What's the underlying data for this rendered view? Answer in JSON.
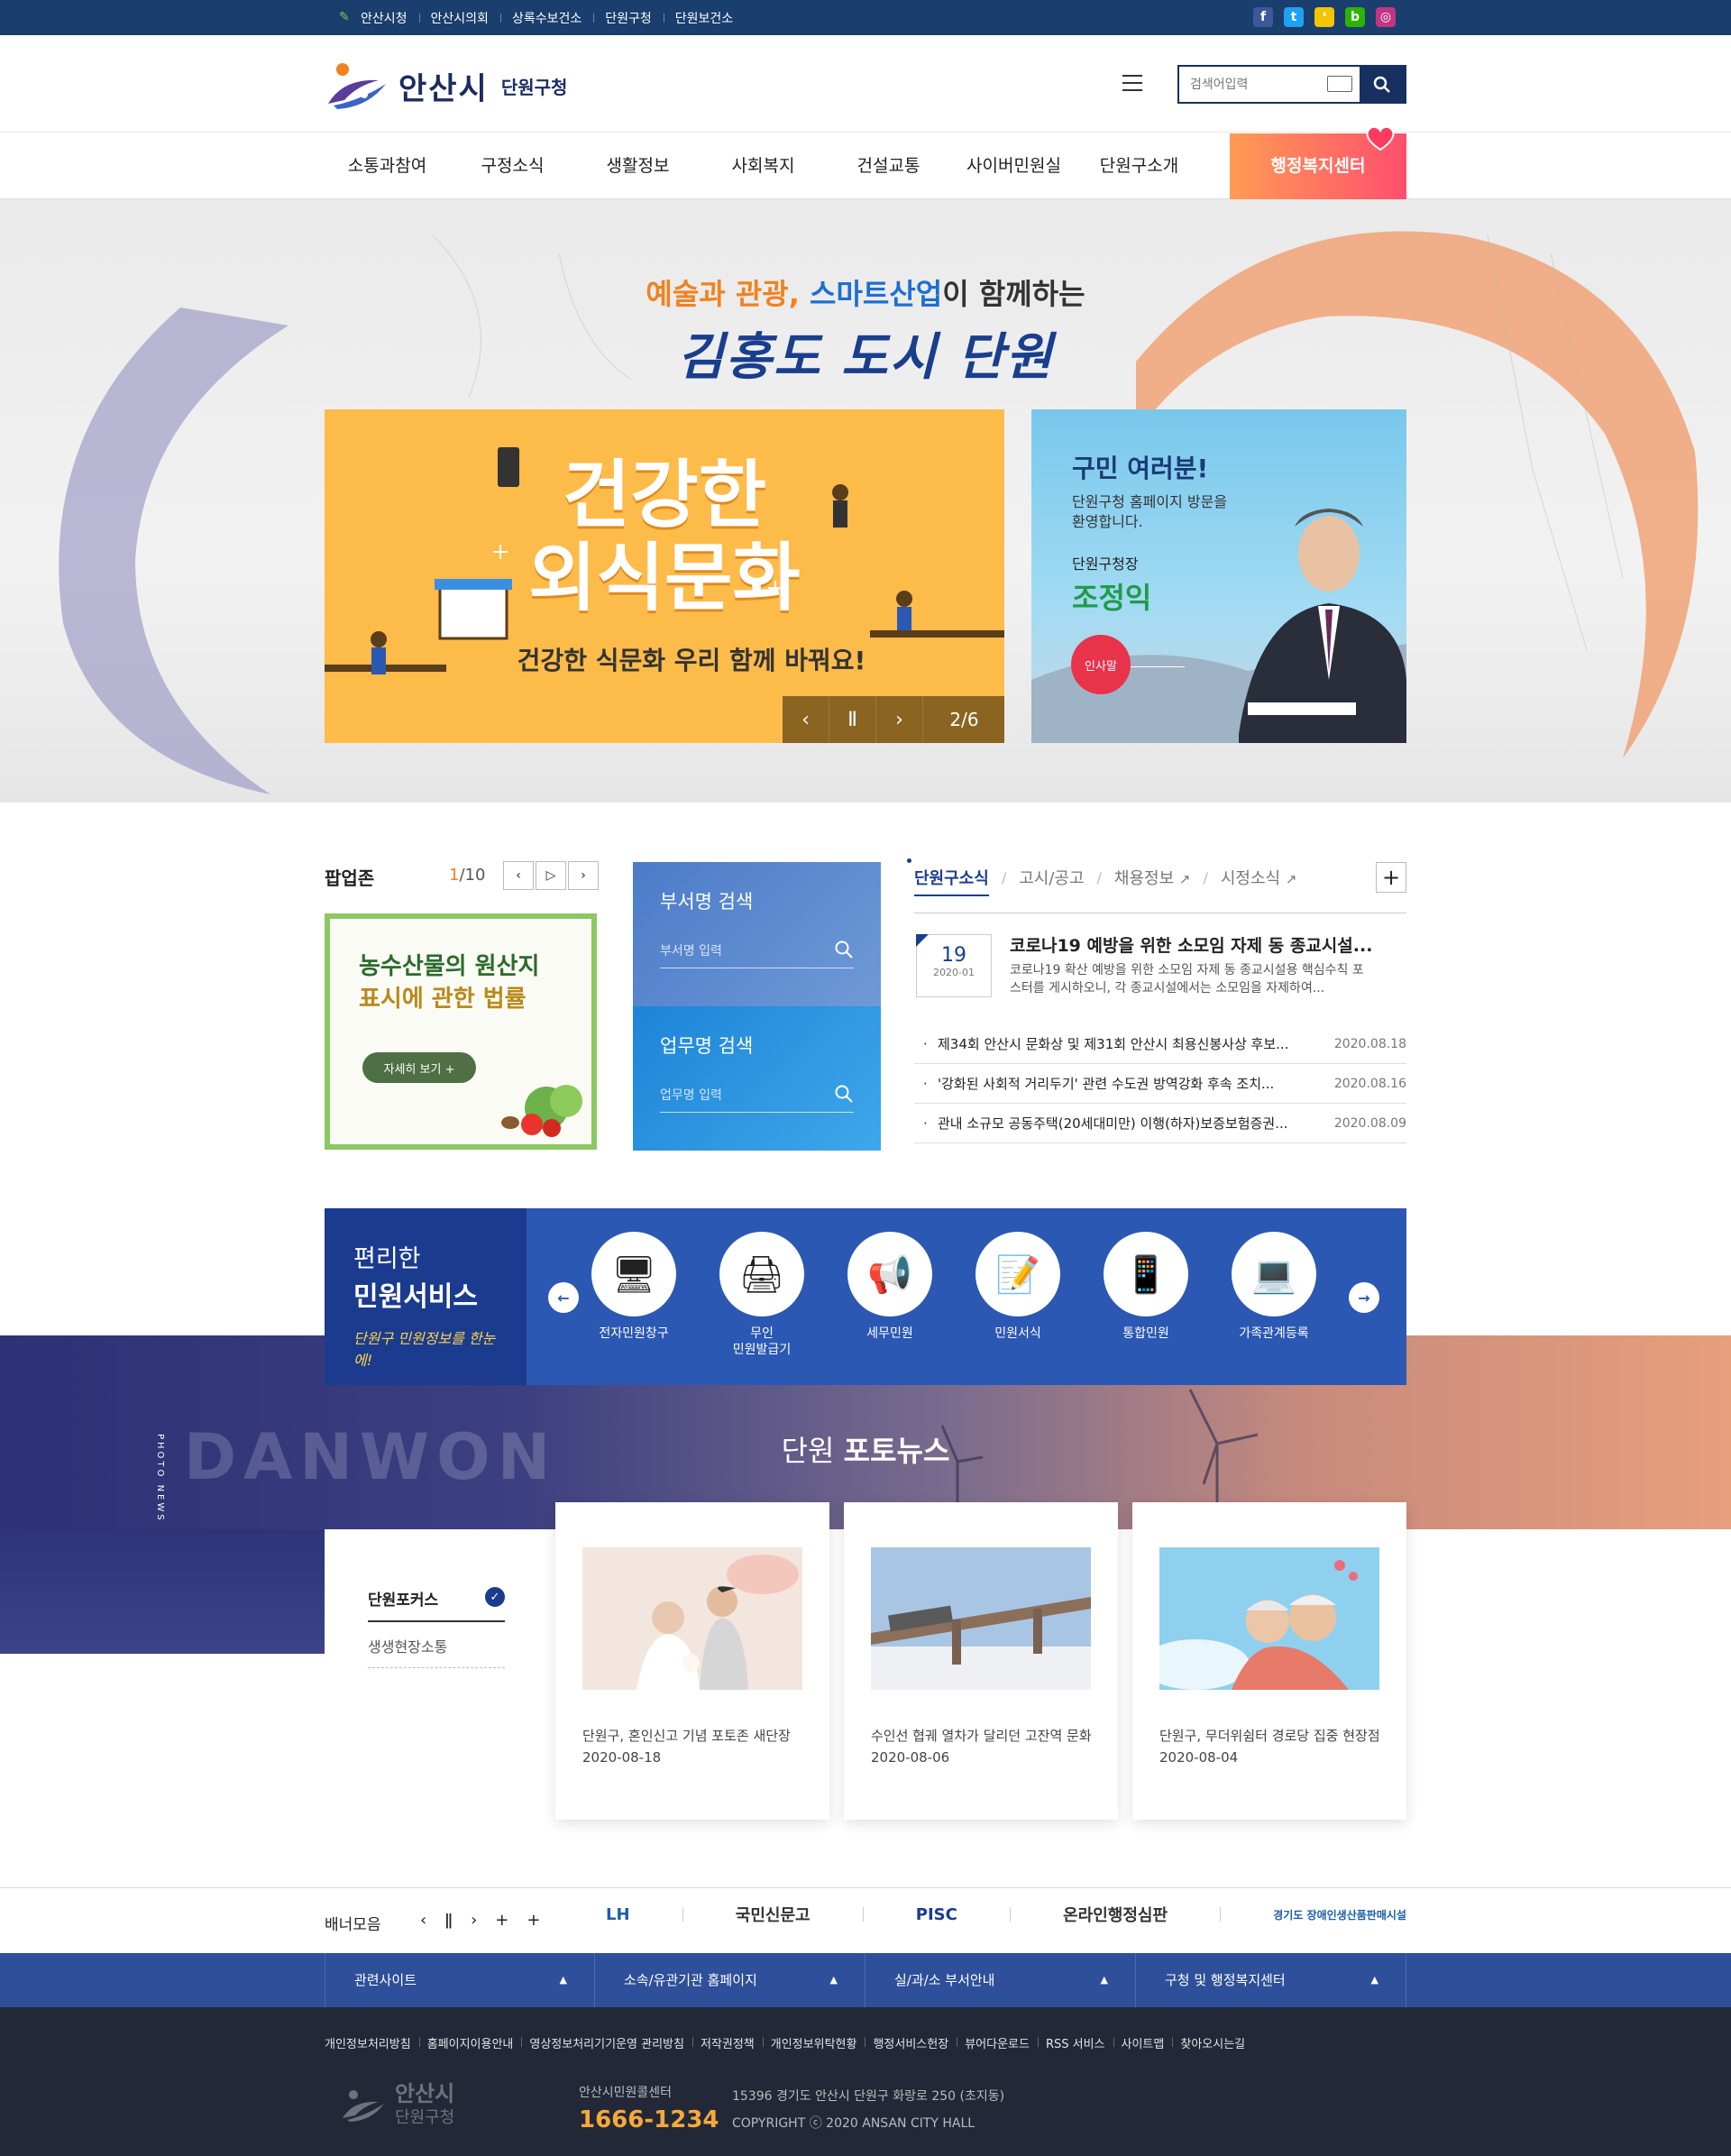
{
  "topbar": {
    "links": [
      "안산시청",
      "안산시의회",
      "상록수보건소",
      "단원구청",
      "단원보건소"
    ],
    "active_index": 0,
    "social_icons": [
      "facebook-icon",
      "twitter-icon",
      "kakaostory-icon",
      "blog-icon",
      "instagram-icon"
    ],
    "social_glyphs": [
      "f",
      "t",
      "❛",
      "b",
      "◎"
    ],
    "social_colors": [
      "#3b5998",
      "#1da1f2",
      "#f4c400",
      "#2db400",
      "#c13584"
    ]
  },
  "header": {
    "logo_main": "안산시",
    "logo_sub": "단원구청",
    "search_placeholder": "검색어입력"
  },
  "gnb": {
    "items": [
      "소통과참여",
      "구정소식",
      "생활정보",
      "사회복지",
      "건설교통",
      "사이버민원실",
      "단원구소개"
    ],
    "special": "행정복지센터",
    "special_colors": [
      "#ff9b54",
      "#ff4f6e"
    ]
  },
  "visual": {
    "slogan_orange": "예술과 관광,",
    "slogan_blue": "스마트산업",
    "slogan_rest": "이 함께하는",
    "slogan_main": "김홍도 도시 단원",
    "banner_title_1": "건강한",
    "banner_title_2": "외식문화",
    "banner_subtitle": "건강한 식문화 우리 함께 바꿔요!",
    "banner_page": "2/6",
    "mayor_greeting": "구민 여러분!",
    "mayor_desc": "단원구청 홈페이지 방문을 환영합니다.",
    "mayor_role": "단원구청장",
    "mayor_name": "조정익",
    "mayor_button": "인사말"
  },
  "popupzone": {
    "title": "팝업존",
    "current": "1",
    "total": "/10",
    "popup_title_1": "농수산물의 원산지",
    "popup_title_2": "표시에 관한 법률",
    "popup_more": "자세히 보기 +"
  },
  "dept_search": {
    "dept_label": "부서명 검색",
    "dept_placeholder": "부서명 입력",
    "task_label": "업무명 검색",
    "task_placeholder": "업무명 입력"
  },
  "news": {
    "tabs": [
      "단원구소식",
      "고시/공고",
      "채용정보",
      "시정소식"
    ],
    "active_tab": 0,
    "featured": {
      "day": "19",
      "month": "2020-01",
      "title": "코로나19 예방을 위한 소모임 자제 동 종교시설...",
      "desc": "코로나19 확산 예방을 위한 소모임 자제 동 종교시설용 핵심수칙 포스터를 게시하오니, 각 종교시설에서는 소모임을 자제하여..."
    },
    "list": [
      {
        "title": "제34회 안산시 문화상 및 제31회 안산시 최용신봉사상 후보...",
        "date": "2020.08.18"
      },
      {
        "title": "'강화된 사회적 거리두기' 관련 수도권 방역강화 후속 조치...",
        "date": "2020.08.16"
      },
      {
        "title": "관내 소규모 공동주택(20세대미만) 이행(하자)보증보험증권...",
        "date": "2020.08.09"
      }
    ]
  },
  "service": {
    "title_1": "편리한",
    "title_2": "민원서비스",
    "tagline": "단원구 민원정보를 한눈에!",
    "items": [
      {
        "label": "전자민원창구",
        "icon": "computer-form-icon"
      },
      {
        "label": "무인\n민원발급기",
        "icon": "printer-icon"
      },
      {
        "label": "세무민원",
        "icon": "megaphone-icon"
      },
      {
        "label": "민원서식",
        "icon": "document-pen-icon"
      },
      {
        "label": "통합민원",
        "icon": "mobile-touch-icon"
      },
      {
        "label": "가족관계등록",
        "icon": "monitor-icon"
      }
    ]
  },
  "photonews": {
    "watermark": "DANWON",
    "vertical_label": "PHOTO NEWS",
    "title_light": "단원",
    "title_bold": "포토뉴스",
    "menu": [
      "단원포커스",
      "생생현장소통"
    ],
    "cards": [
      {
        "title": "단원구, 혼인신고 기념 포토존 새단장",
        "date": "2020-08-18"
      },
      {
        "title": "수인선 협궤 열차가 달리던 고잔역 문화",
        "date": "2020-08-06"
      },
      {
        "title": "단원구, 무더위쉼터 경로당 집중 현장점",
        "date": "2020-08-04"
      }
    ]
  },
  "banners": {
    "title": "배너모음",
    "logos": [
      {
        "text": "LH",
        "color": "#1a5fa8"
      },
      {
        "text": "국민신문고",
        "color": "#333333"
      },
      {
        "text": "PISC",
        "color": "#1b3b8f"
      },
      {
        "text": "온라인행정심판",
        "color": "#333333"
      },
      {
        "text": "경기도 장애인생산품판매시설",
        "color": "#1a5fa8"
      }
    ]
  },
  "footer": {
    "selects": [
      "관련사이트",
      "소속/유관기관 홈페이지",
      "실/과/소 부서안내",
      "구청 및 행정복지센터"
    ],
    "links": [
      "개인정보처리방침",
      "홈페이지이용안내",
      "영상정보처리기기운영 관리방침",
      "저작권정책",
      "개인정보위탁현황",
      "행정서비스헌장",
      "뷰어다운로드",
      "RSS 서비스",
      "사이트맵",
      "찾아오시는길"
    ],
    "logo_main": "안산시",
    "logo_sub": "단원구청",
    "call_label": "안산시민원콜센터",
    "call_number": "1666-1234",
    "address": "15396 경기도 안산시 단원구 화랑로 250 (초지동)",
    "copyright": "COPYRIGHT ⓒ 2020 ANSAN CITY HALL"
  }
}
